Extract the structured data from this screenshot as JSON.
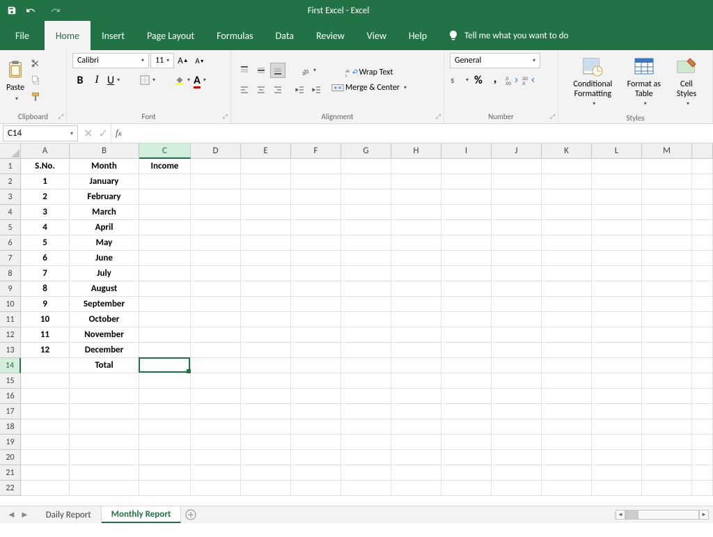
{
  "title": "First Excel  -  Excel",
  "qat": {
    "save_label": "Save",
    "undo_label": "Undo",
    "redo_label": "Redo"
  },
  "tabs": {
    "file": "File",
    "home": "Home",
    "insert": "Insert",
    "pagelayout": "Page Layout",
    "formulas": "Formulas",
    "data": "Data",
    "review": "Review",
    "view": "View",
    "help": "Help",
    "tellme": "Tell me what you want to do"
  },
  "ribbon": {
    "clipboard": {
      "label": "Clipboard",
      "paste": "Paste"
    },
    "font": {
      "label": "Font",
      "name": "Calibri",
      "size": "11"
    },
    "alignment": {
      "label": "Alignment",
      "wrap": "Wrap Text",
      "merge": "Merge & Center"
    },
    "number": {
      "label": "Number",
      "format": "General"
    },
    "styles": {
      "label": "Styles",
      "conditional": "Conditional Formatting",
      "table": "Format as Table",
      "cell": "Cell Styles"
    }
  },
  "formula_bar": {
    "namebox": "C14",
    "value": ""
  },
  "columns": [
    "A",
    "B",
    "C",
    "D",
    "E",
    "F",
    "G",
    "H",
    "I",
    "J",
    "K",
    "L",
    "M"
  ],
  "col_widths": [
    "cA",
    "cB",
    "cC",
    "cD",
    "cE",
    "cF",
    "cG",
    "cH",
    "cI",
    "cJ",
    "cK",
    "cL",
    "cM",
    "cN"
  ],
  "rows_visible": 22,
  "selected_cell": {
    "row": 14,
    "col": "C"
  },
  "data_rows": [
    {
      "A": "S.No.",
      "B": "Month",
      "C": "Income"
    },
    {
      "A": "1",
      "B": "January",
      "C": ""
    },
    {
      "A": "2",
      "B": "February",
      "C": ""
    },
    {
      "A": "3",
      "B": "March",
      "C": ""
    },
    {
      "A": "4",
      "B": "April",
      "C": ""
    },
    {
      "A": "5",
      "B": "May",
      "C": ""
    },
    {
      "A": "6",
      "B": "June",
      "C": ""
    },
    {
      "A": "7",
      "B": "July",
      "C": ""
    },
    {
      "A": "8",
      "B": "August",
      "C": ""
    },
    {
      "A": "9",
      "B": "September",
      "C": ""
    },
    {
      "A": "10",
      "B": "October",
      "C": ""
    },
    {
      "A": "11",
      "B": "November",
      "C": ""
    },
    {
      "A": "12",
      "B": "December",
      "C": ""
    },
    {
      "A": "",
      "B": "Total",
      "C": ""
    }
  ],
  "sheets": {
    "tabs": [
      {
        "name": "Daily Report",
        "active": false
      },
      {
        "name": "Monthly Report",
        "active": true
      }
    ]
  }
}
